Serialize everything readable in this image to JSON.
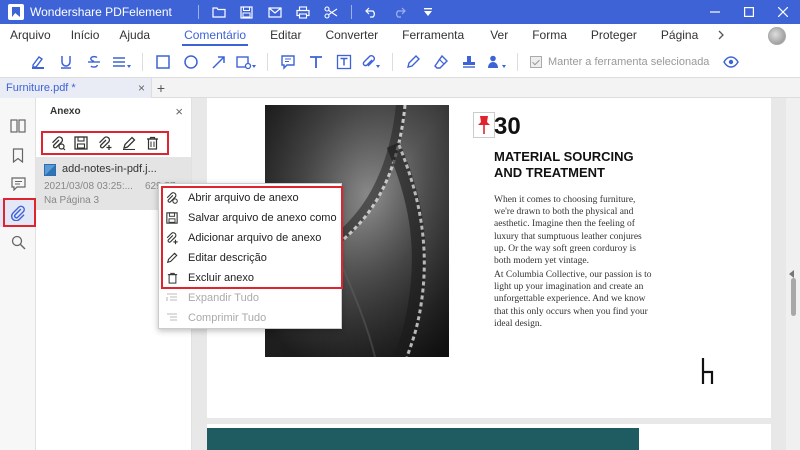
{
  "app": {
    "title": "Wondershare PDFelement"
  },
  "menu": {
    "items": [
      "Arquivo",
      "Início",
      "Ajuda",
      "Comentário",
      "Editar",
      "Converter",
      "Ferramenta",
      "Ver",
      "Forma",
      "Proteger",
      "Página"
    ],
    "active": "Comentário",
    "more_icon": "chevron-right-icon"
  },
  "toolbar": {
    "keep_tool_label": "Manter a ferramenta selecionada",
    "keep_tool_checked": true
  },
  "tabs": {
    "document_tab": "Furniture.pdf *",
    "add_tab": "+"
  },
  "attachment_panel": {
    "title": "Anexo",
    "close": "×",
    "file": {
      "name": "add-notes-in-pdf.j...",
      "date": "2021/03/08 03:25:...",
      "size": "629,57",
      "page": "Na Página 3"
    }
  },
  "context_menu": {
    "items": [
      {
        "label": "Abrir arquivo de anexo",
        "icon": "open-attachment-icon",
        "enabled": true
      },
      {
        "label": "Salvar arquivo de anexo como",
        "icon": "save-icon",
        "enabled": true
      },
      {
        "label": "Adicionar arquivo de anexo",
        "icon": "add-attachment-icon",
        "enabled": true
      },
      {
        "label": "Editar descrição",
        "icon": "pencil-icon",
        "enabled": true
      },
      {
        "label": "Excluir anexo",
        "icon": "trash-icon",
        "enabled": true
      },
      {
        "label": "Expandir Tudo",
        "icon": "expand-icon",
        "enabled": false
      },
      {
        "label": "Comprimir Tudo",
        "icon": "collapse-icon",
        "enabled": false
      }
    ]
  },
  "document": {
    "number": "30",
    "heading": "MATERIAL SOURCING AND TREATMENT",
    "paragraph1": "When it comes to choosing furniture, we're drawn to both the physical and aesthetic. Imagine then the feeling of luxury that sumptuous leather conjures up. Or the way soft green corduroy is both modern yet vintage.",
    "paragraph2": "At Columbia Collective, our passion is to light up your imagination and create an unforgettable experience. And we know that this only occurs when you find your ideal design."
  },
  "colors": {
    "accent": "#3d63d6",
    "highlight": "#e0242f",
    "band": "#1f5c62"
  }
}
